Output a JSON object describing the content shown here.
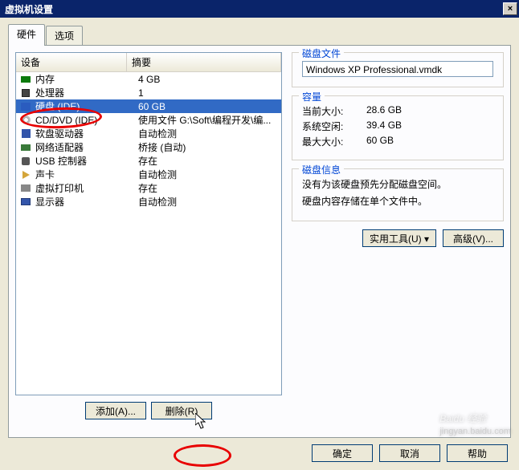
{
  "window": {
    "title": "虚拟机设置",
    "close": "×"
  },
  "tabs": {
    "hardware": "硬件",
    "options": "选项"
  },
  "list": {
    "head_device": "设备",
    "head_summary": "摘要",
    "items": [
      {
        "name": "内存",
        "summary": "4 GB",
        "icon": "ic-mem"
      },
      {
        "name": "处理器",
        "summary": "1",
        "icon": "ic-cpu"
      },
      {
        "name": "硬盘 (IDE)",
        "summary": "60 GB",
        "icon": "ic-hdd",
        "selected": true
      },
      {
        "name": "CD/DVD (IDE)",
        "summary": "使用文件 G:\\Soft\\编程开发\\编...",
        "icon": "ic-cd"
      },
      {
        "name": "软盘驱动器",
        "summary": "自动检测",
        "icon": "ic-fd"
      },
      {
        "name": "网络适配器",
        "summary": "桥接 (自动)",
        "icon": "ic-nic"
      },
      {
        "name": "USB 控制器",
        "summary": "存在",
        "icon": "ic-usb"
      },
      {
        "name": "声卡",
        "summary": "自动检测",
        "icon": "ic-snd"
      },
      {
        "name": "虚拟打印机",
        "summary": "存在",
        "icon": "ic-prn"
      },
      {
        "name": "显示器",
        "summary": "自动检测",
        "icon": "ic-mon"
      }
    ]
  },
  "leftbuttons": {
    "add": "添加(A)...",
    "remove": "删除(R)"
  },
  "panel": {
    "diskfile": {
      "legend": "磁盘文件",
      "value": "Windows XP Professional.vmdk"
    },
    "capacity": {
      "legend": "容量",
      "current_label": "当前大小:",
      "current_value": "28.6 GB",
      "sysfree_label": "系统空闲:",
      "sysfree_value": "39.4 GB",
      "max_label": "最大大小:",
      "max_value": "60 GB"
    },
    "diskinfo": {
      "legend": "磁盘信息",
      "line1": "没有为该硬盘预先分配磁盘空间。",
      "line2": "硬盘内容存储在单个文件中。"
    },
    "buttons": {
      "utilities": "实用工具(U) ▾",
      "advanced": "高级(V)..."
    }
  },
  "footer": {
    "ok": "确定",
    "cancel": "取消",
    "help": "帮助"
  },
  "watermark": {
    "brand": "Baidu 经验",
    "url": "jingyan.baidu.com"
  }
}
